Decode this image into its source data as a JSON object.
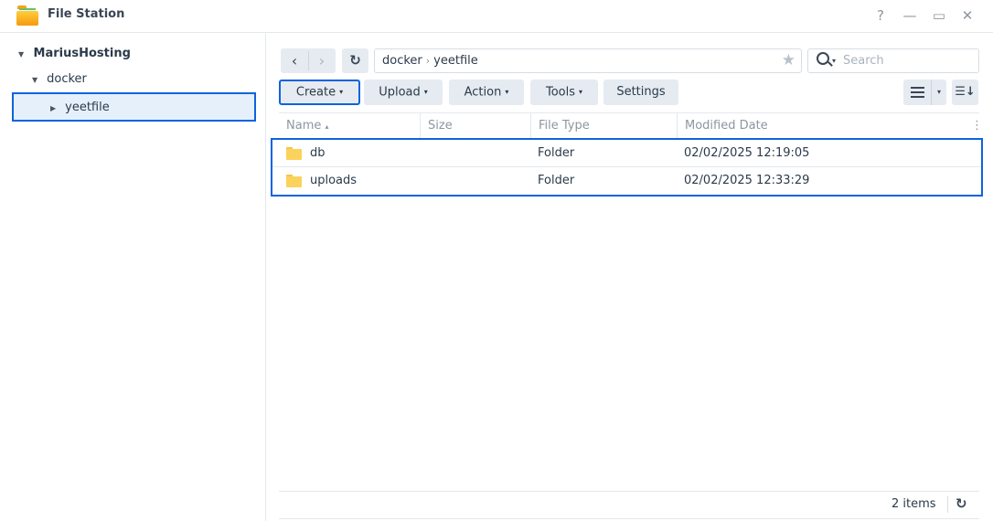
{
  "window": {
    "title": "File Station",
    "controls": {
      "help": "?",
      "minimize": "—",
      "maximize": "▭",
      "close": "✕"
    }
  },
  "sidebar": {
    "tree": [
      {
        "label": "MariusHosting",
        "expanded": true,
        "level": 0
      },
      {
        "label": "docker",
        "expanded": true,
        "level": 1
      },
      {
        "label": "yeetfile",
        "expanded": false,
        "level": 2,
        "selected": true
      }
    ]
  },
  "toolbar": {
    "back_icon": "‹",
    "forward_icon": "›",
    "refresh_icon": "↻",
    "path": [
      "docker",
      "yeetfile"
    ],
    "path_separator": "›",
    "favorite_icon": "★",
    "search": {
      "placeholder": "Search",
      "value": ""
    },
    "buttons": [
      {
        "label": "Create",
        "has_menu": true,
        "active": true
      },
      {
        "label": "Upload",
        "has_menu": true
      },
      {
        "label": "Action",
        "has_menu": true
      },
      {
        "label": "Tools",
        "has_menu": true
      },
      {
        "label": "Settings",
        "has_menu": false
      }
    ],
    "dropdown_caret": "▾",
    "sort_icon": "☰↓"
  },
  "table": {
    "columns": [
      {
        "label": "Name",
        "sort": "asc",
        "sort_indicator": "▴"
      },
      {
        "label": "Size"
      },
      {
        "label": "File Type"
      },
      {
        "label": "Modified Date"
      }
    ],
    "column_menu_icon": "⋮",
    "rows": [
      {
        "name": "db",
        "size": "",
        "type": "Folder",
        "modified": "02/02/2025 12:19:05"
      },
      {
        "name": "uploads",
        "size": "",
        "type": "Folder",
        "modified": "02/02/2025 12:33:29"
      }
    ]
  },
  "footer": {
    "items_count": "2 items",
    "refresh_icon": "↻"
  },
  "colors": {
    "accent": "#0d63e0",
    "selected_bg": "#e6f0fb",
    "button_bg": "#e6ebf1",
    "folder": "#fbd25c"
  }
}
